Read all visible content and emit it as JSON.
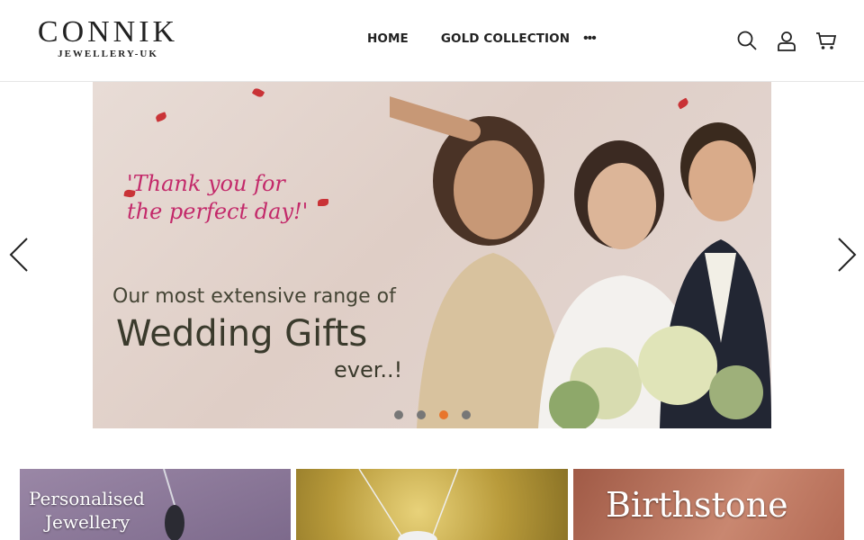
{
  "brand": {
    "name": "CONNIK",
    "sub": "JEWELLERY-UK"
  },
  "nav": {
    "items": [
      {
        "label": "HOME"
      },
      {
        "label": "GOLD COLLECTION"
      }
    ],
    "more_label": "•••"
  },
  "header_icons": {
    "search": "search-icon",
    "account": "user-icon",
    "cart": "cart-icon"
  },
  "hero": {
    "script_line1": "'Thank you for",
    "script_line2": "the perfect day!'",
    "line1": "Our most extensive range of",
    "line2": "Wedding Gifts",
    "line3": "ever..!",
    "active_slide": 3,
    "slide_count": 4
  },
  "tiles": [
    {
      "title_line1": "Personalised",
      "title_line2": "Jewellery"
    },
    {
      "title_line1": "",
      "title_line2": ""
    },
    {
      "title_line1": "Birthstone",
      "title_line2": ""
    }
  ],
  "colors": {
    "accent": "#e8752c",
    "text": "#222222",
    "script": "#c3296a"
  }
}
